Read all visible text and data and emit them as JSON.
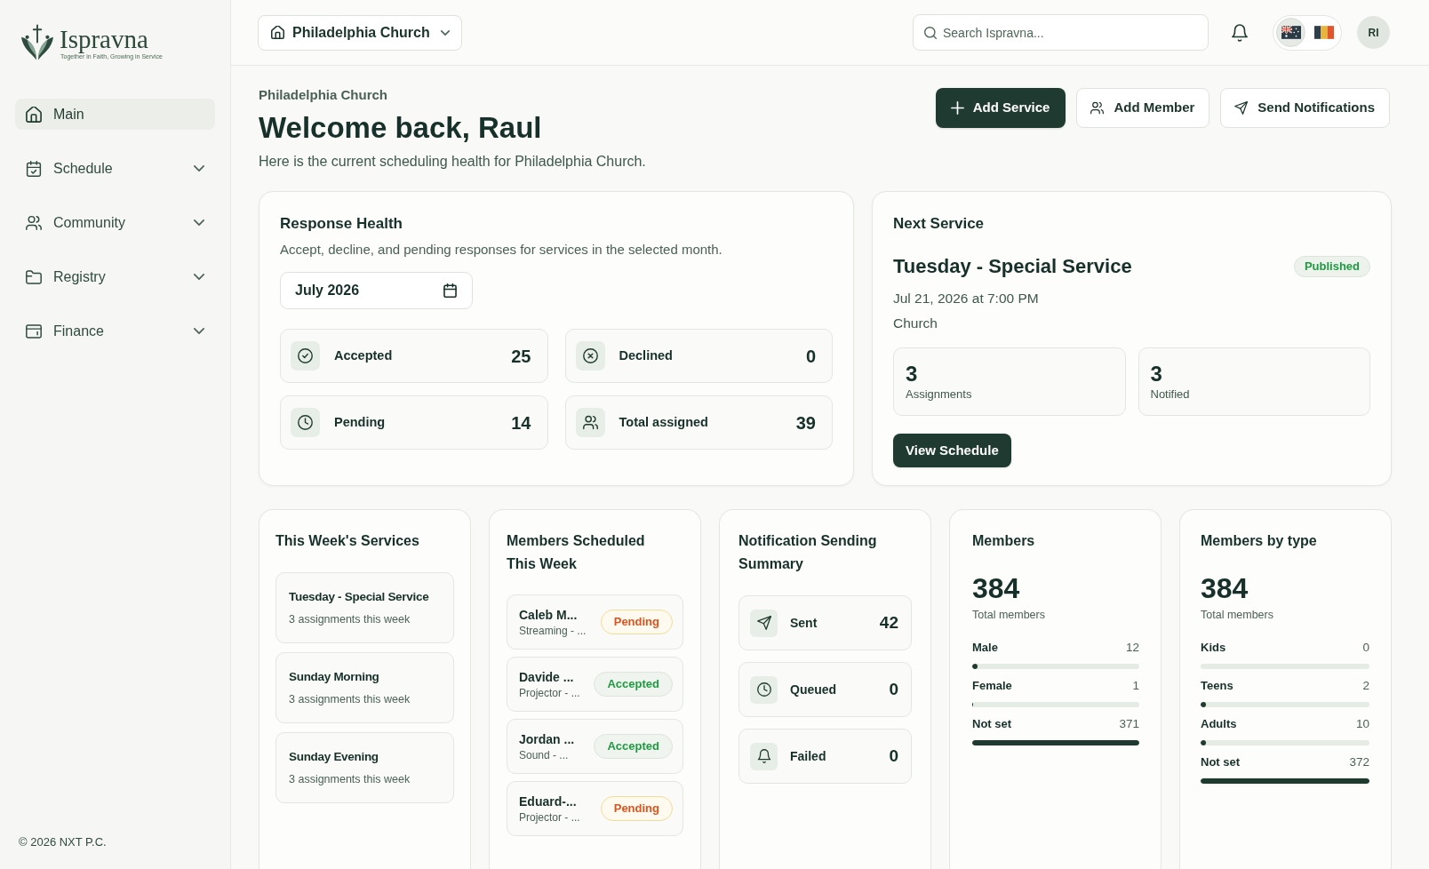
{
  "sidebar": {
    "logo": {
      "name": "Ispravna",
      "tagline": "Together in Faith, Growing in Service"
    },
    "items": [
      {
        "label": "Main",
        "kind": "link",
        "selected": true
      },
      {
        "label": "Schedule",
        "kind": "group",
        "selected": false,
        "expanded": false
      },
      {
        "label": "Community",
        "kind": "group",
        "selected": false,
        "expanded": false
      },
      {
        "label": "Registry",
        "kind": "group",
        "selected": false,
        "expanded": false
      },
      {
        "label": "Finance",
        "kind": "group",
        "selected": false,
        "expanded": false
      }
    ],
    "footer": "© 2026 NXT P.C."
  },
  "header": {
    "church_selector": "Philadelphia Church",
    "search": {
      "placeholder": "Search Ispravna..."
    },
    "languages": [
      {
        "kind": "ensign",
        "selected": true
      },
      {
        "kind": "tricolor",
        "selected": false
      }
    ],
    "avatar": "RI"
  },
  "page": {
    "eyebrow": "Philadelphia Church",
    "title": "Welcome back, Raul",
    "subtitle": "Here is the current scheduling health for Philadelphia Church.",
    "actions": [
      {
        "label": "Add Service",
        "kind": "primary"
      },
      {
        "label": "Add Member",
        "kind": "secondary"
      },
      {
        "label": "Send Notifications",
        "kind": "secondary"
      }
    ]
  },
  "response_health": {
    "title": "Response Health",
    "description": "Accept, decline, and pending responses for services in the selected month.",
    "month": "July 2026",
    "stats": [
      {
        "label": "Accepted",
        "value": "25"
      },
      {
        "label": "Declined",
        "value": "0"
      },
      {
        "label": "Pending",
        "value": "14"
      },
      {
        "label": "Total assigned",
        "value": "39"
      }
    ]
  },
  "next_service": {
    "heading": "Next Service",
    "title": "Tuesday - Special Service",
    "status": {
      "label": "Published",
      "kind": "published"
    },
    "datetime": "Jul 21, 2026 at 7:00 PM",
    "location": "Church",
    "stats": [
      {
        "value": "3",
        "label": "Assignments"
      },
      {
        "value": "3",
        "label": "Notified"
      }
    ],
    "button": "View Schedule"
  },
  "this_weeks_services": {
    "title": "This Week's Services",
    "items": [
      {
        "name": "Tuesday - Special Service",
        "detail": "3 assignments this week"
      },
      {
        "name": "Sunday Morning",
        "detail": "3 assignments this week"
      },
      {
        "name": "Sunday Evening",
        "detail": "3 assignments this week"
      }
    ]
  },
  "members_scheduled": {
    "title": "Members Scheduled This Week",
    "items": [
      {
        "name": "Caleb M...",
        "role": "Streaming - ...",
        "status": "Pending",
        "kind": "pending"
      },
      {
        "name": "Davide ...",
        "role": "Projector - ...",
        "status": "Accepted",
        "kind": "accepted"
      },
      {
        "name": "Jordan ...",
        "role": "Sound - ...",
        "status": "Accepted",
        "kind": "accepted"
      },
      {
        "name": "Eduard-...",
        "role": "Projector - ...",
        "status": "Pending",
        "kind": "pending"
      }
    ]
  },
  "notification_summary": {
    "title": "Notification Sending Summary",
    "items": [
      {
        "label": "Sent",
        "value": "42"
      },
      {
        "label": "Queued",
        "value": "0"
      },
      {
        "label": "Failed",
        "value": "0"
      }
    ]
  },
  "members": {
    "title": "Members",
    "total": "384",
    "total_label": "Total members",
    "rows": [
      {
        "label": "Male",
        "count": "12",
        "level": 0.03
      },
      {
        "label": "Female",
        "count": "1",
        "level": 0.005
      },
      {
        "label": "Not set",
        "count": "371",
        "level": 1
      }
    ]
  },
  "members_by_type": {
    "title": "Members by type",
    "total": "384",
    "total_label": "Total members",
    "rows": [
      {
        "label": "Kids",
        "count": "0",
        "level": 0
      },
      {
        "label": "Teens",
        "count": "2",
        "level": 0.03
      },
      {
        "label": "Adults",
        "count": "10",
        "level": 0.03
      },
      {
        "label": "Not set",
        "count": "372",
        "level": 1
      }
    ]
  }
}
